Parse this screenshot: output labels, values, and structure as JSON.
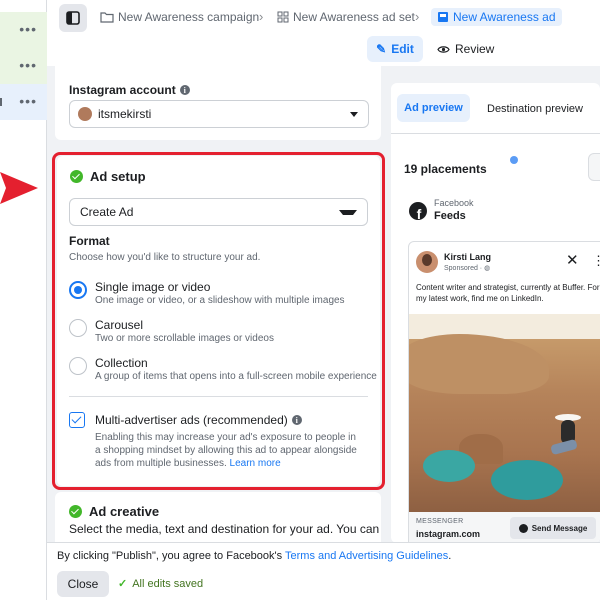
{
  "breadcrumb": {
    "campaign": "New Awareness campaign",
    "adset": "New Awareness ad set",
    "ad": "New Awareness ad"
  },
  "mode": {
    "edit": "Edit",
    "review": "Review"
  },
  "instagram": {
    "label": "Instagram account",
    "value": "itsmekirsti"
  },
  "ad_setup": {
    "title": "Ad setup",
    "create_value": "Create Ad",
    "format_title": "Format",
    "format_sub": "Choose how you'd like to structure your ad.",
    "options": [
      {
        "label": "Single image or video",
        "desc": "One image or video, or a slideshow with multiple images",
        "selected": true
      },
      {
        "label": "Carousel",
        "desc": "Two or more scrollable images or videos",
        "selected": false
      },
      {
        "label": "Collection",
        "desc": "A group of items that opens into a full-screen mobile experience",
        "selected": false
      }
    ],
    "multi_label": "Multi-advertiser ads (recommended)",
    "multi_desc": "Enabling this may increase your ad's exposure to people in a shopping mindset by allowing this ad to appear alongside ads from multiple businesses.",
    "learn_more": "Learn more"
  },
  "ad_creative": {
    "title": "Ad creative",
    "sub": "Select the media, text and destination for your ad. You can"
  },
  "preview": {
    "tab_ad": "Ad preview",
    "tab_dest": "Destination preview",
    "placements": "19 placements",
    "platform": "Facebook",
    "placement": "Feeds",
    "post": {
      "name": "Kirsti Lang",
      "sponsored": "Sponsored · ",
      "text": "Content writer and strategist, currently at Buffer. For my latest work, find me on LinkedIn.",
      "footer_label": "MESSENGER",
      "domain": "instagram.com",
      "cta": "Send Message"
    }
  },
  "footer": {
    "terms_prefix": "By clicking \"Publish\", you agree to Facebook's ",
    "terms_link": "Terms and Advertising Guidelines",
    "terms_suffix": ".",
    "close": "Close",
    "saved": "All edits saved"
  },
  "colors": {
    "accent": "#1877f2",
    "success": "#42b72a",
    "highlight": "#e4202f"
  }
}
